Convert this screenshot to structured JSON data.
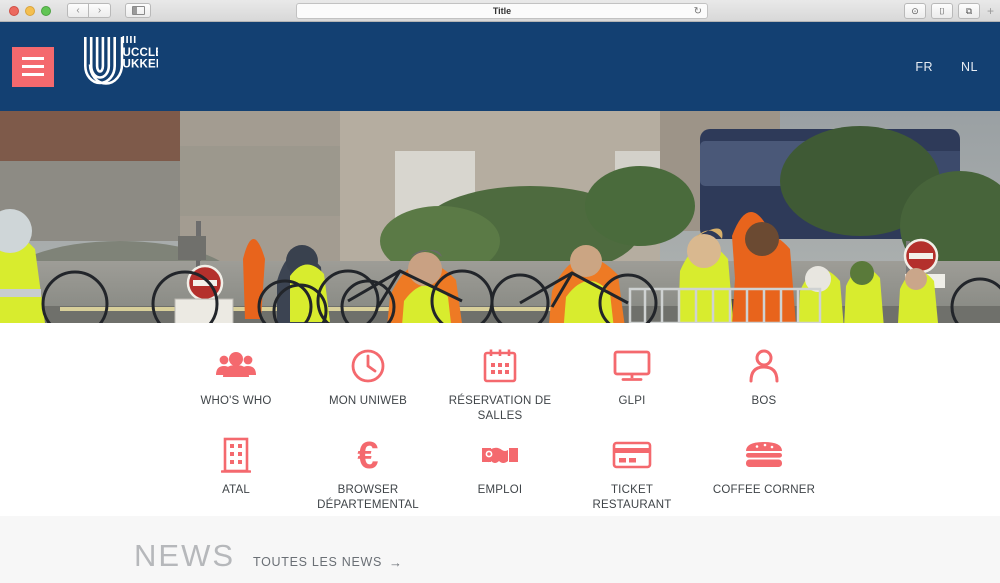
{
  "browser": {
    "title": "Title",
    "back_label": "‹",
    "forward_label": "›",
    "reload_label": "↻",
    "sidebar_name": "sidebar-toggle",
    "right_buttons": [
      {
        "name": "share-button",
        "glyph": "⊙"
      },
      {
        "name": "reader-button",
        "glyph": "⌷"
      },
      {
        "name": "tabs-button",
        "glyph": "⧉"
      }
    ],
    "new_tab_label": "+"
  },
  "header": {
    "menu_label": "Menu",
    "logo": {
      "line1": "UCCLE",
      "line2": "UKKEL"
    },
    "lang": [
      {
        "code": "FR"
      },
      {
        "code": "NL"
      }
    ]
  },
  "hero": {
    "alt": "Cyclists wearing high-visibility vests gathered on a street"
  },
  "quicklinks": [
    {
      "icon": "people-group-icon",
      "label": "WHO'S WHO"
    },
    {
      "icon": "clock-icon",
      "label": "MON UNIWEB"
    },
    {
      "icon": "calendar-icon",
      "label": "RÉSERVATION DE SALLES"
    },
    {
      "icon": "monitor-icon",
      "label": "GLPI"
    },
    {
      "icon": "person-icon",
      "label": "BOS"
    },
    {
      "icon": "building-icon",
      "label": "ATAL"
    },
    {
      "icon": "euro-icon",
      "label": "BROWSER DÉPARTEMENTAL"
    },
    {
      "icon": "handshake-icon",
      "label": "EMPLOI"
    },
    {
      "icon": "credit-card-icon",
      "label": "TICKET RESTAURANT"
    },
    {
      "icon": "burger-icon",
      "label": "COFFEE CORNER"
    }
  ],
  "news": {
    "title": "NEWS",
    "link_label": "TOUTES LES NEWS",
    "arrow": "→"
  },
  "colors": {
    "header_blue": "#134072",
    "accent_red": "#f4696e",
    "news_bg": "#f7f7f7",
    "label_grey": "#3f4448"
  }
}
